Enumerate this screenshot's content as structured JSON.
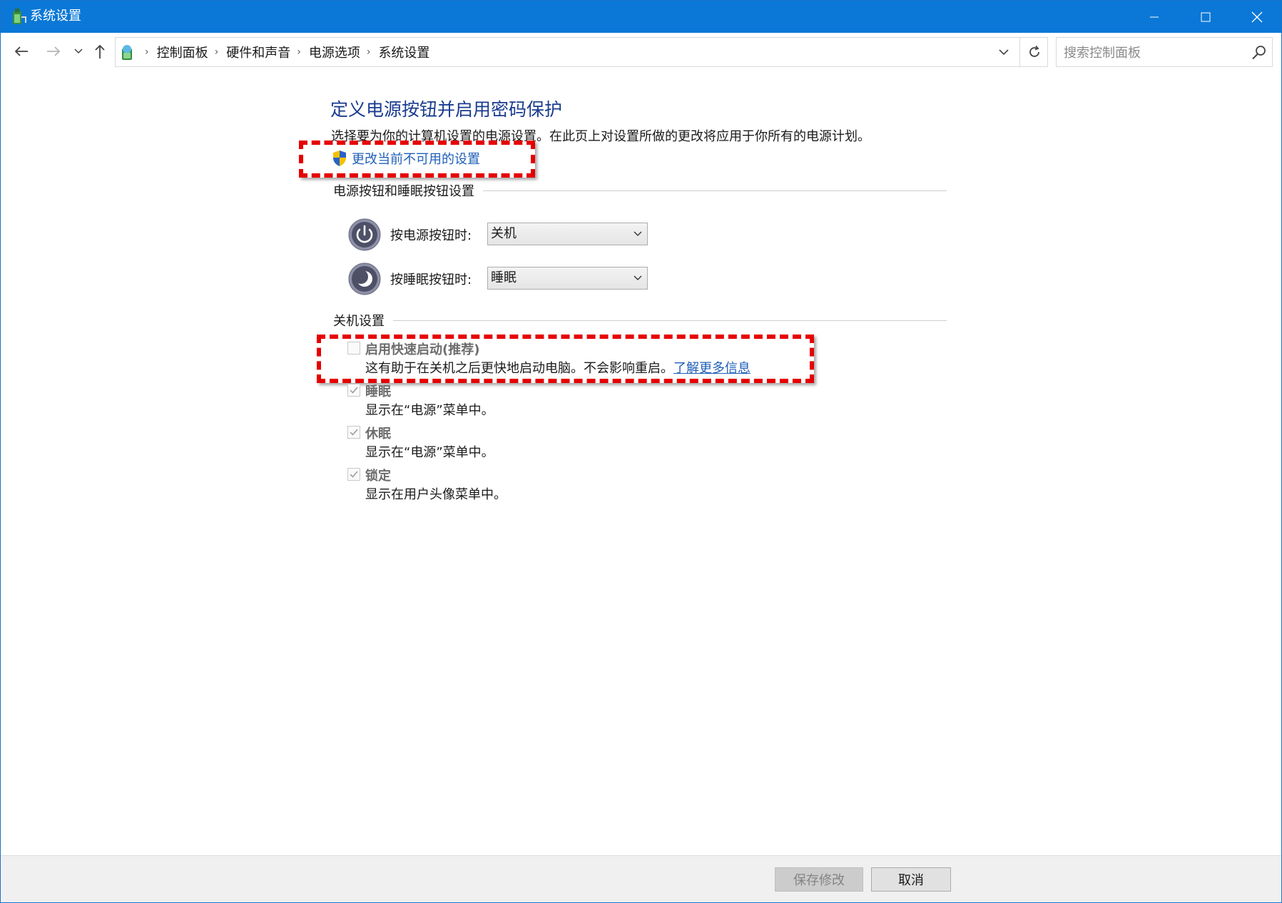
{
  "window": {
    "title": "系统设置"
  },
  "address": {
    "breadcrumb": [
      "控制面板",
      "硬件和声音",
      "电源选项",
      "系统设置"
    ]
  },
  "search": {
    "placeholder": "搜索控制面板"
  },
  "page": {
    "title": "定义电源按钮并启用密码保护",
    "description": "选择要为你的计算机设置的电源设置。在此页上对设置所做的更改将应用于你所有的电源计划。",
    "change_link": "更改当前不可用的设置"
  },
  "buttons_group": {
    "header": "电源按钮和睡眠按钮设置",
    "power": {
      "label": "按电源按钮时:",
      "value": "关机"
    },
    "sleep": {
      "label": "按睡眠按钮时:",
      "value": "睡眠"
    }
  },
  "shutdown_group": {
    "header": "关机设置",
    "options": [
      {
        "label": "启用快速启动(推荐)",
        "desc": "这有助于在关机之后更快地启动电脑。不会影响重启。",
        "link": "了解更多信息",
        "checked": false
      },
      {
        "label": "睡眠",
        "desc": "显示在“电源”菜单中。",
        "checked": true
      },
      {
        "label": "休眠",
        "desc": "显示在“电源”菜单中。",
        "checked": true
      },
      {
        "label": "锁定",
        "desc": "显示在用户头像菜单中。",
        "checked": true
      }
    ]
  },
  "footer": {
    "save": "保存修改",
    "cancel": "取消"
  },
  "colors": {
    "titlebar": "#0b78d7",
    "link": "#1f5fb8",
    "title": "#1a3b8f",
    "annotation": "#e60000"
  }
}
